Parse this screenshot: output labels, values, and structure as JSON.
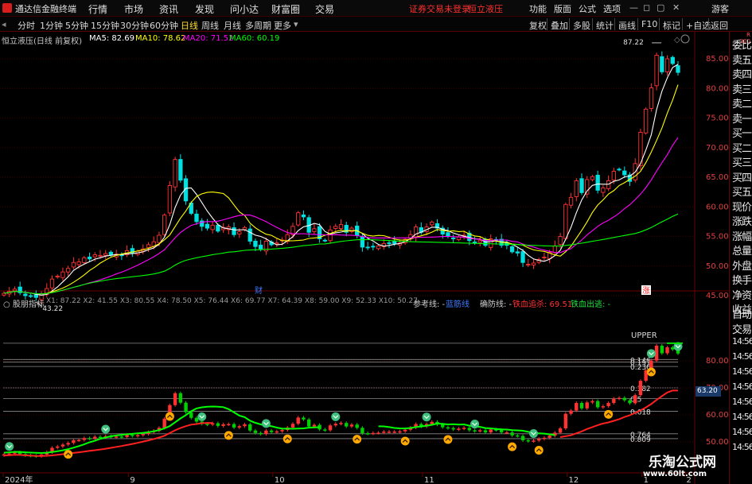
{
  "app": {
    "title": "通达信金融终端",
    "guest": "游客"
  },
  "menu": [
    "行情",
    "市场",
    "资讯",
    "发现",
    "问小达",
    "财富圈",
    "交易"
  ],
  "status": {
    "broker": "证券交易未登录",
    "stock": "恒立液压"
  },
  "toolbar": [
    "功能",
    "版面",
    "公式",
    "选项"
  ],
  "periods": [
    "分时",
    "1分钟",
    "5分钟",
    "15分钟",
    "30分钟",
    "60分钟",
    "日线",
    "周线",
    "月线",
    "多周期",
    "更多"
  ],
  "active_period": "日线",
  "right_tools": [
    "复权",
    "叠加",
    "多股",
    "统计",
    "画线",
    "F10",
    "标记",
    "+自选",
    "返回"
  ],
  "main_info": {
    "name": "恒立液压(日线 前复权)",
    "ma5": "MA5: 82.69",
    "ma10": "MA10: 78.62",
    "ma20": "MA20: 71.52",
    "ma60": "MA60: 60.19"
  },
  "indicator_info": {
    "name": "股朋指标",
    "x_values": "X1: 87.22  X2: 41.55  X3: 80.55  X4: 78.50  X5: 76.44  X6: 69.77  X7: 64.39  X8: 59.00  X9: 52.33  X10: 50.27",
    "ref": "参考线: -",
    "blue": "蓝筋线",
    "guard": "确防线: -",
    "chase": "铁血追杀: 69.51",
    "exit": "铁血出逃: -"
  },
  "price_axis": [
    "85.00",
    "80.00",
    "75.00",
    "70.00",
    "65.00",
    "60.00",
    "55.00",
    "50.00",
    "45.00"
  ],
  "ind_axis": [
    "80.00",
    "70.00",
    "60.00",
    "50.00"
  ],
  "fib_labels": [
    "UPPER",
    "0.146",
    "0.191",
    "0.236",
    "0.382",
    "0.5",
    "0.618",
    "0.764",
    "0.809"
  ],
  "price_marks": {
    "high": "87.22",
    "low": "43.22"
  },
  "event_marks": [
    "财",
    "涨"
  ],
  "date_axis": [
    "2024年",
    "9",
    "10",
    "11",
    "12",
    "1",
    "2"
  ],
  "value_badge": "63.20",
  "right_panel": [
    "委比",
    "卖五",
    "卖四",
    "卖三",
    "卖二",
    "卖一",
    "买一",
    "买二",
    "买三",
    "买四",
    "买五",
    "现价",
    "涨跌",
    "涨幅",
    "总量",
    "外盘",
    "换手",
    "净资",
    "收益"
  ],
  "right_panel_bottom": [
    "自动",
    "交易",
    "14:56",
    "14:56",
    "14:56",
    "14:56",
    "14:56",
    "14:56",
    "14:56",
    "14:56"
  ],
  "right_panel_corner": [
    "R",
    "300"
  ],
  "watermark": {
    "title": "乐淘公式网",
    "url": "www.60lt.com"
  },
  "colors": {
    "up": "#ff3232",
    "down": "#00e0e0",
    "ma5": "#ffffff",
    "ma10": "#ffff00",
    "ma20": "#ff00ff",
    "ma60": "#00ff00",
    "ind_up": "#ff3232",
    "ind_down": "#00d000",
    "blue_line": "#00ff00",
    "red_line": "#ff2020",
    "buy_icon": "#ffaa00",
    "sell_icon": "#40c080"
  },
  "chart_data": {
    "type": "candlestick",
    "title": "恒立液压(日线 前复权)",
    "dates_axis_ticks": [
      "2024年",
      "9",
      "10",
      "11",
      "12",
      "1",
      "2"
    ],
    "ylim": [
      42,
      89
    ],
    "closes": [
      45.4,
      45.7,
      46.1,
      45.5,
      45.0,
      44.9,
      44.7,
      45.3,
      46.2,
      47.8,
      48.3,
      49.0,
      49.6,
      50.6,
      50.7,
      51.4,
      51.2,
      51.9,
      51.8,
      52.1,
      51.9,
      52.0,
      51.8,
      52.6,
      52.2,
      52.5,
      52.9,
      53.6,
      54.1,
      55.2,
      58.6,
      63.6,
      68.0,
      64.5,
      61.0,
      58.9,
      57.5,
      56.7,
      56.4,
      56.9,
      55.9,
      56.5,
      56.6,
      55.3,
      55.8,
      56.5,
      54.2,
      53.3,
      52.9,
      54.2,
      53.6,
      53.9,
      54.4,
      55.3,
      56.7,
      59.0,
      58.3,
      55.7,
      56.3,
      54.6,
      54.3,
      56.1,
      56.7,
      57.0,
      55.7,
      56.4,
      55.2,
      53.2,
      53.1,
      53.3,
      53.4,
      53.8,
      53.8,
      53.8,
      53.9,
      54.5,
      55.3,
      56.6,
      55.7,
      56.6,
      57.4,
      56.4,
      55.4,
      55.1,
      54.6,
      54.9,
      55.2,
      54.3,
      54.0,
      54.3,
      53.5,
      54.6,
      54.4,
      53.5,
      53.5,
      52.4,
      52.2,
      50.6,
      50.3,
      50.5,
      51.1,
      51.5,
      52.3,
      53.4,
      55.0,
      60.4,
      61.6,
      64.4,
      62.4,
      64.6,
      65.1,
      62.8,
      63.2,
      64.4,
      66.0,
      66.3,
      65.4,
      64.3,
      67.3,
      72.6,
      76.5,
      80.1,
      85.6,
      82.8,
      85.0,
      84.2,
      82.7
    ],
    "ma5": [
      45.4,
      45.55,
      45.73,
      45.68,
      45.54,
      45.44,
      45.24,
      45.08,
      45.22,
      45.78,
      46.46,
      47.32,
      48.18,
      49.26,
      49.84,
      50.32,
      50.74,
      51.16,
      51.4,
      51.68,
      51.82,
      51.94,
      51.92,
      52.08,
      52.1,
      52.22,
      52.4,
      52.76,
      53.06,
      53.66,
      54.88,
      57.02,
      59.9,
      61.98,
      63.14,
      63.2,
      62.1,
      60.72,
      59.3,
      58.08,
      57.0,
      56.44,
      56.3,
      56.12,
      56.1,
      56.14,
      55.68,
      55.22,
      55.0,
      54.6,
      54.04,
      53.58,
      53.68,
      54.28,
      54.96,
      55.98,
      56.62,
      56.84,
      57.2,
      56.98,
      55.84,
      55.4,
      55.6,
      55.74,
      55.96,
      55.98,
      55.98,
      55.5,
      54.68,
      54.24,
      53.64,
      53.36,
      53.48,
      53.68,
      53.8,
      54.12,
      54.64,
      55.4,
      55.72,
      56.14,
      56.56,
      56.56,
      56.2,
      55.98,
      55.58,
      55.28,
      55.04,
      54.82,
      54.6,
      54.54,
      54.06,
      54.12,
      54.26,
      54.06,
      54.06,
      53.68,
      53.2,
      52.64,
      51.8,
      51.2,
      50.94,
      50.8,
      51.16,
      51.76,
      52.66,
      54.52,
      56.56,
      59.02,
      61.16,
      62.68,
      63.62,
      63.86,
      63.82,
      63.82,
      64.3,
      64.54,
      65.06,
      65.2,
      65.86,
      67.3,
      69.62,
      72.16,
      76.42,
      79.52,
      81.8,
      83.54,
      84.06
    ],
    "ma10": [
      45.4,
      45.55,
      45.73,
      45.68,
      45.54,
      45.43,
      45.33,
      45.29,
      45.4,
      45.66,
      45.95,
      46.28,
      46.72,
      47.26,
      47.84,
      48.5,
      49.25,
      49.82,
      50.51,
      51.02,
      51.49,
      51.79,
      52.02,
      52.22,
      52.37,
      52.54,
      52.74,
      52.99,
      53.34,
      53.74,
      54.43,
      55.26,
      56.66,
      58.07,
      59.31,
      60.75,
      61.77,
      62.2,
      62.44,
      62.5,
      62.4,
      62.25,
      61.52,
      60.32,
      59.15,
      58.54,
      57.24,
      56.46,
      55.87,
      55.37,
      55.19,
      54.69,
      54.27,
      54.27,
      54.26,
      54.31,
      54.4,
      54.66,
      54.74,
      54.84,
      55.2,
      55.5,
      55.82,
      56.06,
      55.89,
      56.01,
      55.92,
      55.54,
      55.19,
      55.06,
      55.17,
      55.14,
      54.86,
      54.54,
      54.41,
      54.38,
      54.54,
      54.88,
      55.11,
      55.38,
      55.72,
      56.18,
      56.04,
      55.87,
      55.95,
      55.82,
      55.87,
      55.4,
      55.08,
      54.97,
      54.52,
      54.39,
      54.2,
      54.02,
      53.97,
      53.72,
      53.66,
      53.52,
      53.1,
      52.73,
      52.58,
      52.47,
      52.2,
      51.86,
      51.67,
      52.41,
      53.35,
      54.71,
      56.02,
      57.44,
      59.06,
      60.32,
      61.17,
      62.15,
      62.73,
      63.61,
      64.07,
      64.65,
      65.17,
      65.99,
      67.47,
      69.24,
      71.22,
      73.29,
      75.83,
      78.05,
      80.62
    ],
    "ma20": [
      45.4,
      45.55,
      45.73,
      45.68,
      45.54,
      45.43,
      45.33,
      45.29,
      45.35,
      45.51,
      45.71,
      45.93,
      46.15,
      46.41,
      46.64,
      46.89,
      47.17,
      47.4,
      47.67,
      47.98,
      48.3,
      48.66,
      48.97,
      49.34,
      49.74,
      50.16,
      50.61,
      51.07,
      51.57,
      52.11,
      52.76,
      53.75,
      54.79,
      55.66,
      56.31,
      56.87,
      57.13,
      57.4,
      57.52,
      57.5,
      57.58,
      57.81,
      58.08,
      58.31,
      58.55,
      58.64,
      58.61,
      58.32,
      57.9,
      57.49,
      56.98,
      56.53,
      56.08,
      55.65,
      55.46,
      55.43,
      55.47,
      55.4,
      55.35,
      55.29,
      55.27,
      55.27,
      55.3,
      55.24,
      55.21,
      55.21,
      55.13,
      54.98,
      54.82,
      54.75,
      54.74,
      54.76,
      54.72,
      54.72,
      54.76,
      54.76,
      54.76,
      54.82,
      54.86,
      54.86,
      54.89,
      54.92,
      54.98,
      55.0,
      54.97,
      54.92,
      54.85,
      54.69,
      54.57,
      54.49,
      54.3,
      54.31,
      54.39,
      54.39,
      54.38,
      54.17,
      54.07,
      53.71,
      53.43,
      53.22,
      52.9,
      52.69,
      52.47,
      52.27,
      52.27,
      52.62,
      52.95,
      53.68,
      54.39,
      55.26,
      55.97,
      56.7,
      57.28,
      57.72,
      58.3,
      58.92,
      59.7,
      60.35,
      61.23,
      62.14,
      63.25,
      64.54,
      66.04,
      67.44,
      68.8,
      70.4,
      71.7
    ],
    "ma60": [
      45.4,
      45.55,
      45.73,
      45.68,
      45.54,
      45.43,
      45.33,
      45.29,
      45.35,
      45.51,
      45.71,
      45.93,
      46.15,
      46.41,
      46.64,
      46.89,
      47.09,
      47.29,
      47.46,
      47.62,
      47.75,
      47.87,
      47.98,
      48.09,
      48.19,
      48.29,
      48.39,
      48.52,
      48.67,
      48.86,
      49.14,
      49.59,
      50.17,
      50.63,
      50.97,
      51.19,
      51.4,
      51.58,
      51.74,
      51.92,
      52.05,
      52.2,
      52.35,
      52.41,
      52.53,
      52.65,
      52.71,
      52.75,
      52.77,
      52.83,
      52.87,
      52.93,
      53.0,
      53.08,
      53.18,
      53.32,
      53.44,
      53.52,
      53.62,
      53.72,
      53.74,
      53.87,
      54.02,
      54.15,
      54.26,
      54.36,
      54.43,
      54.45,
      54.46,
      54.44,
      54.39,
      54.35,
      54.3,
      54.25,
      54.2,
      54.16,
      54.12,
      54.09,
      54.07,
      54.05,
      54.03,
      54.01,
      53.98,
      53.96,
      53.93,
      53.91,
      53.89,
      53.86,
      53.83,
      53.81,
      53.78,
      53.76,
      53.73,
      53.72,
      53.69,
      53.66,
      53.63,
      53.58,
      53.53,
      53.49,
      53.45,
      53.42,
      53.39,
      53.37,
      53.39,
      53.48,
      53.58,
      53.72,
      53.86,
      54.02,
      54.18,
      54.33,
      54.49,
      54.65,
      54.82,
      55.0,
      55.16,
      55.32,
      55.49,
      55.76,
      56.11,
      56.5,
      57.0,
      57.47,
      57.93,
      58.38,
      58.8
    ]
  }
}
